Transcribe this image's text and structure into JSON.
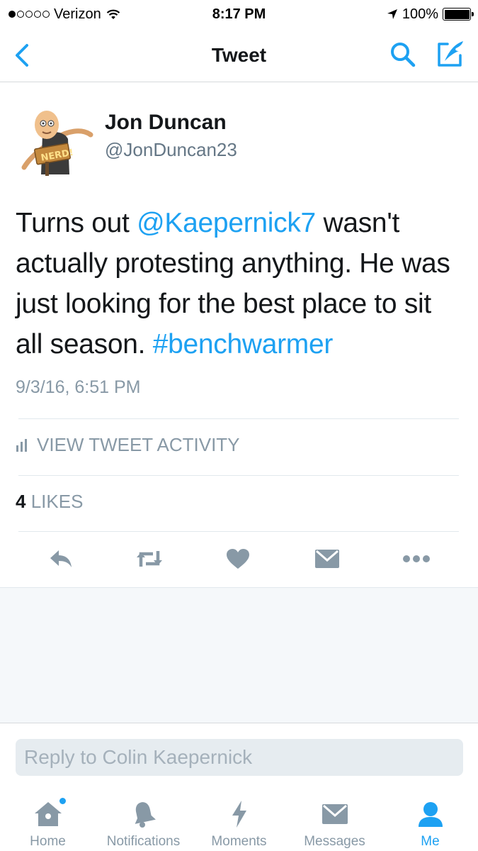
{
  "status_bar": {
    "carrier": "Verizon",
    "time": "8:17 PM",
    "battery": "100%",
    "battery_level": 1.0
  },
  "nav": {
    "title": "Tweet"
  },
  "tweet": {
    "author_name": "Jon Duncan",
    "author_handle": "@JonDuncan23",
    "avatar_badge_text": "NERD!",
    "text_prefix": "Turns out ",
    "mention": "@Kaepernick7",
    "text_middle": " wasn't actually protesting anything. He was just looking for the best place to sit all season. ",
    "hashtag": "#benchwarmer",
    "timestamp": "9/3/16, 6:51 PM",
    "activity_label": "VIEW TWEET ACTIVITY",
    "likes_count": "4",
    "likes_label": "LIKES"
  },
  "actions": [
    {
      "name": "reply-icon"
    },
    {
      "name": "retweet-icon"
    },
    {
      "name": "like-icon"
    },
    {
      "name": "direct-message-icon"
    },
    {
      "name": "more-icon"
    }
  ],
  "reply": {
    "placeholder": "Reply to Colin Kaepernick"
  },
  "tabs": [
    {
      "label": "Home",
      "icon": "home-icon",
      "active": false
    },
    {
      "label": "Notifications",
      "icon": "bell-icon",
      "active": false
    },
    {
      "label": "Moments",
      "icon": "lightning-icon",
      "active": false
    },
    {
      "label": "Messages",
      "icon": "envelope-icon",
      "active": false
    },
    {
      "label": "Me",
      "icon": "person-icon",
      "active": true
    }
  ],
  "colors": {
    "accent": "#1da1f2",
    "secondary_text": "#8899a6",
    "icon_gray": "#8899a6"
  }
}
